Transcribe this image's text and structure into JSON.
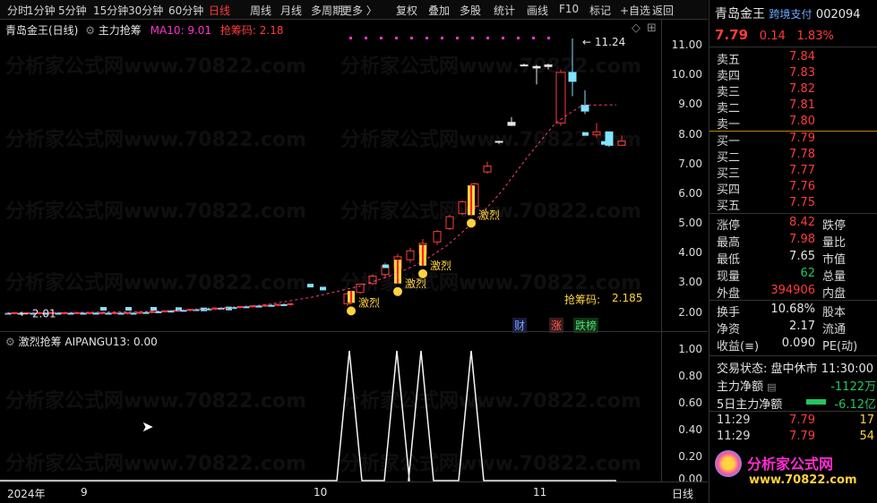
{
  "toolbar": {
    "items": [
      "分时",
      "1分钟",
      "5分钟",
      "15分钟",
      "30分钟",
      "60分钟",
      "日线",
      "周线",
      "月线",
      "多周期",
      "更多 〉",
      "复权",
      "叠加",
      "多股",
      "统计",
      "画线",
      "F10",
      "标记",
      "+自选",
      "返回"
    ],
    "active_index": 6
  },
  "chart_header": {
    "stock": "青岛金王(日线)",
    "indicator": "主力抢筹",
    "ma_label": "MA10: 9.01",
    "chou_label": "抢筹码: 2.18"
  },
  "main_chart": {
    "price_labels": [
      "11.00",
      "10.00",
      "9.00",
      "8.00",
      "7.00",
      "6.00",
      "5.00",
      "4.00",
      "3.00",
      "2.00"
    ],
    "high_marker": "11.24",
    "low_marker": "2.01",
    "signal_text": "激烈",
    "chou_bottom_label": "抢筹码:",
    "chou_bottom_value": "2.185",
    "badges": [
      "财",
      "涨",
      "跌榜"
    ]
  },
  "indicator_chart": {
    "title": "激烈抢筹 AIPANGU13: 0.00",
    "y_labels": [
      "1.00",
      "0.80",
      "0.60",
      "0.40",
      "0.20",
      "0.00"
    ]
  },
  "time_axis": {
    "labels": [
      "2024年",
      "9",
      "10",
      "11"
    ],
    "right_label": "日线"
  },
  "watermark": {
    "text": "分析家公式网www.70822.com"
  },
  "quote": {
    "name": "青岛金王",
    "badge": "跨境支付",
    "code": "002094",
    "price": "7.79",
    "change": "0.14",
    "change_pct": "1.83%",
    "sell": [
      {
        "label": "卖五",
        "price": "7.84"
      },
      {
        "label": "卖四",
        "price": "7.83"
      },
      {
        "label": "卖三",
        "price": "7.82"
      },
      {
        "label": "卖二",
        "price": "7.81"
      },
      {
        "label": "卖一",
        "price": "7.80"
      }
    ],
    "buy": [
      {
        "label": "买一",
        "price": "7.79"
      },
      {
        "label": "买二",
        "price": "7.78"
      },
      {
        "label": "买三",
        "price": "7.77"
      },
      {
        "label": "买四",
        "price": "7.76"
      },
      {
        "label": "买五",
        "price": "7.75"
      }
    ],
    "stats": [
      {
        "k": "涨停",
        "v": "8.42",
        "vclass": "red",
        "k2": "跌停"
      },
      {
        "k": "最高",
        "v": "7.98",
        "vclass": "red",
        "k2": "量比"
      },
      {
        "k": "最低",
        "v": "7.65",
        "vclass": "white",
        "k2": "市值"
      },
      {
        "k": "现量",
        "v": "62",
        "vclass": "green",
        "k2": "总量"
      },
      {
        "k": "外盘",
        "v": "394906",
        "vclass": "red",
        "k2": "内盘"
      }
    ],
    "stats2": [
      {
        "k": "换手",
        "v": "10.68%",
        "k2": "股本"
      },
      {
        "k": "净资",
        "v": "2.17",
        "k2": "流通"
      },
      {
        "k": "收益(≡)",
        "v": "0.090",
        "k2": "PE(动)"
      }
    ],
    "trade_status_label": "交易状态:",
    "trade_status": "盘中休市",
    "trade_time": "11:30:00",
    "flow1_label": "主力净额",
    "flow1_value": "-1122万",
    "flow2_label": "5日主力净额",
    "flow2_value": "-6.12亿",
    "ticks": [
      {
        "time": "11:29",
        "price": "7.79",
        "vol": "17"
      },
      {
        "time": "11:29",
        "price": "7.79",
        "vol": "54"
      }
    ],
    "logo_text": "分析家公式网",
    "logo_url": "www.70822.com"
  }
}
